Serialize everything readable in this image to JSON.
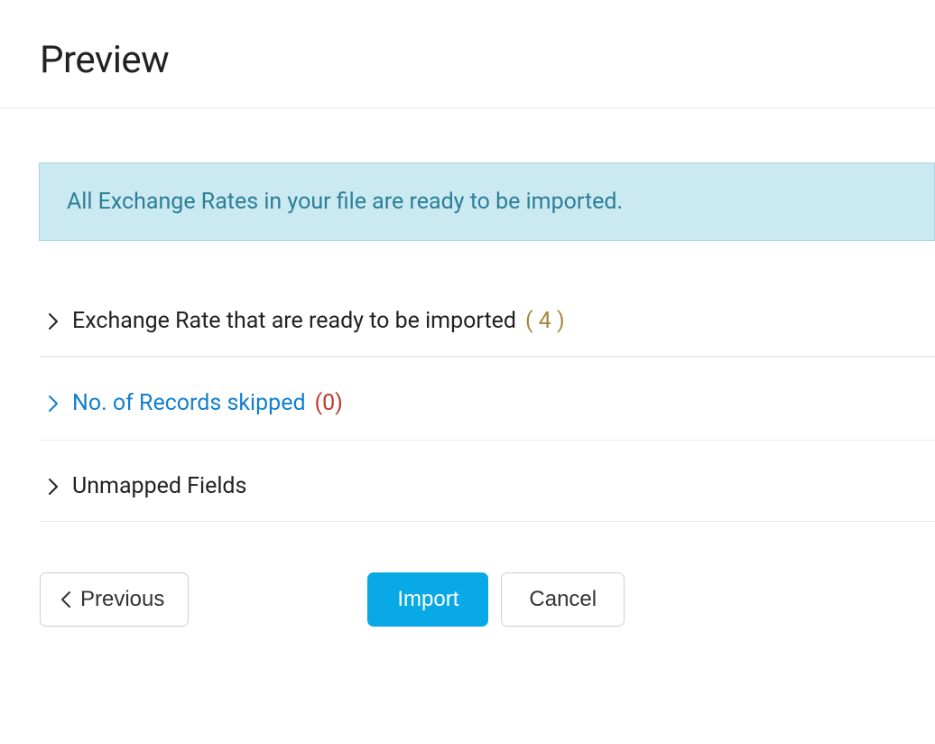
{
  "header": {
    "title": "Preview"
  },
  "banner": {
    "message": "All Exchange Rates in your file are ready to be imported."
  },
  "sections": {
    "ready": {
      "label": "Exchange Rate that are ready to be imported",
      "count": "( 4 )"
    },
    "skipped": {
      "label": "No. of Records skipped",
      "count": "(0)"
    },
    "unmapped": {
      "label": "Unmapped Fields"
    }
  },
  "buttons": {
    "previous": "Previous",
    "import": "Import",
    "cancel": "Cancel"
  }
}
